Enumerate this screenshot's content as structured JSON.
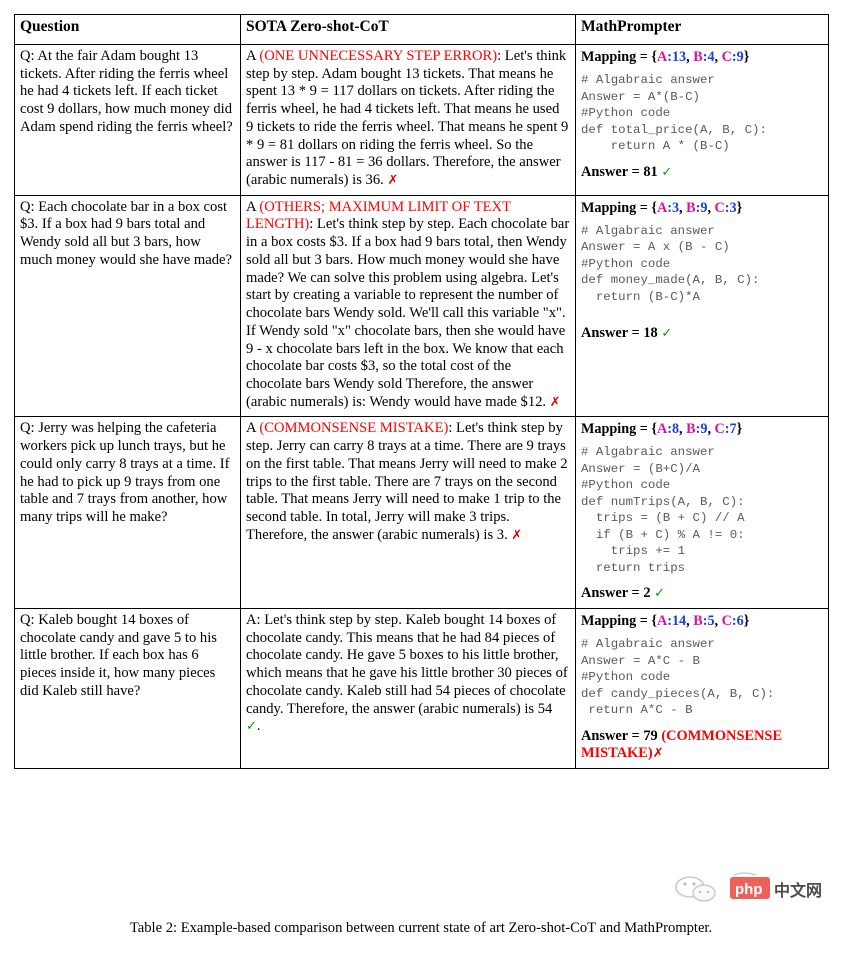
{
  "table": {
    "headers": [
      "Question",
      "SOTA Zero-shot-CoT",
      "MathPrompter"
    ],
    "rows": [
      {
        "question": "Q: At the fair Adam bought 13 tickets. After riding the ferris wheel he had 4 tickets left. If each ticket cost 9 dollars, how much money did Adam spend riding the ferris wheel?",
        "cot": {
          "prefix": "A ",
          "error_tag": "(ONE UNNECESSARY STEP ERROR)",
          "body": ": Let's think step by step. Adam bought 13 tickets. That means he spent 13 * 9 = 117 dollars on tickets. After riding the ferris wheel, he had 4 tickets left. That means he used 9 tickets to ride the ferris wheel. That means he spent 9 * 9 = 81 dollars on riding the ferris wheel. So the answer is 117 - 81 = 36 dollars. Therefore, the answer (arabic numerals) is 36. ",
          "verdict": "wrong",
          "verdict_glyph": "✗"
        },
        "mp": {
          "mapping_label": "Mapping = ",
          "mapping": [
            {
              "var": "A",
              "value": "13"
            },
            {
              "var": "B",
              "value": "4"
            },
            {
              "var": "C",
              "value": "9"
            }
          ],
          "code": "# Algabraic answer\nAnswer = A*(B-C)\n#Python code\ndef total_price(A, B, C):\n    return A * (B-C)",
          "answer_label": "Answer = ",
          "answer_value": "81",
          "verdict": "right",
          "verdict_glyph": "✓",
          "answer_note": ""
        }
      },
      {
        "question": "Q: Each chocolate bar in a box cost $3. If a box had 9 bars total and Wendy sold all but 3 bars, how much money would she have made?",
        "cot": {
          "prefix": "A ",
          "error_tag": "(OTHERS; MAXIMUM LIMIT OF TEXT LENGTH)",
          "body": ": Let's think step by step. Each chocolate bar in a box costs $3. If a box had 9 bars total, then Wendy sold all but 3 bars. How much money would she have made? We can solve this problem using algebra. Let's start by creating a variable to represent the number of chocolate bars Wendy sold. We'll call this variable \"x\". If Wendy sold \"x\" chocolate bars, then she would have 9 - x chocolate bars left in the box. We know that each chocolate bar costs $3, so the total cost of the chocolate bars Wendy sold Therefore, the answer (arabic numerals) is: Wendy would have made $12. ",
          "verdict": "wrong",
          "verdict_glyph": "✗"
        },
        "mp": {
          "mapping_label": "Mapping = ",
          "mapping": [
            {
              "var": "A",
              "value": "3"
            },
            {
              "var": "B",
              "value": "9"
            },
            {
              "var": "C",
              "value": "3"
            }
          ],
          "code": "# Algabraic answer\nAnswer = A x (B - C)\n#Python code\ndef money_made(A, B, C):\n  return (B-C)*A",
          "answer_label": "Answer = ",
          "answer_value": "18",
          "verdict": "right",
          "verdict_glyph": "✓",
          "answer_note": ""
        }
      },
      {
        "question": "Q: Jerry was helping the cafeteria workers pick up lunch trays, but he could only carry 8 trays at a time. If he had to pick up 9 trays from one table and 7 trays from another, how many trips will he make?",
        "cot": {
          "prefix": "A ",
          "error_tag": "(COMMONSENSE MISTAKE)",
          "body": ": Let's think step by step. Jerry can carry 8 trays at a time. There are 9 trays on the first table. That means Jerry will need to make 2 trips to the first table. There are 7 trays on the second table. That means Jerry will need to make 1 trip to the second table. In total, Jerry will make 3 trips. Therefore, the answer (arabic numerals) is 3. ",
          "verdict": "wrong",
          "verdict_glyph": "✗"
        },
        "mp": {
          "mapping_label": "Mapping = ",
          "mapping": [
            {
              "var": "A",
              "value": "8"
            },
            {
              "var": "B",
              "value": "9"
            },
            {
              "var": "C",
              "value": "7"
            }
          ],
          "code": "# Algabraic answer\nAnswer = (B+C)/A\n#Python code\ndef numTrips(A, B, C):\n  trips = (B + C) // A\n  if (B + C) % A != 0:\n    trips += 1\n  return trips",
          "answer_label": "Answer = ",
          "answer_value": "2",
          "verdict": "right",
          "verdict_glyph": "✓",
          "answer_note": ""
        }
      },
      {
        "question": "Q: Kaleb bought 14 boxes of chocolate candy and gave 5 to his little brother. If each box has 6 pieces inside it, how many pieces did Kaleb still have?",
        "cot": {
          "prefix": "",
          "error_tag": "",
          "body": "A: Let's think step by step. Kaleb bought 14 boxes of chocolate candy. This means that he had 84 pieces of chocolate candy. He gave 5 boxes to his little brother, which means that he gave his little brother 30 pieces of chocolate candy. Kaleb still had 54 pieces of chocolate candy. Therefore, the answer (arabic numerals) is 54 ",
          "verdict": "right",
          "verdict_glyph": "✓",
          "suffix": "."
        },
        "mp": {
          "mapping_label": "Mapping = ",
          "mapping": [
            {
              "var": "A",
              "value": "14"
            },
            {
              "var": "B",
              "value": "5"
            },
            {
              "var": "C",
              "value": "6"
            }
          ],
          "code": "# Algabraic answer\nAnswer = A*C - B\n#Python code\ndef candy_pieces(A, B, C):\n return A*C - B",
          "answer_label": "Answer = ",
          "answer_value": "79",
          "verdict": "wrong",
          "verdict_glyph": "✗",
          "answer_note": "(COMMONSENSE MISTAKE)"
        }
      }
    ]
  },
  "caption": {
    "label": "Table 2:",
    "text": "Example-based comparison between current state of art Zero-shot-CoT and MathPrompter."
  },
  "watermark": {
    "text": "php中文网",
    "color": "#e8413a"
  },
  "colors": {
    "error_red": "#ff0000",
    "check_green": "#009900",
    "cross_red": "#e00000",
    "var_pink": "#e0119d",
    "num_blue": "#1a3fe0",
    "code_gray": "#5a5a5a"
  }
}
